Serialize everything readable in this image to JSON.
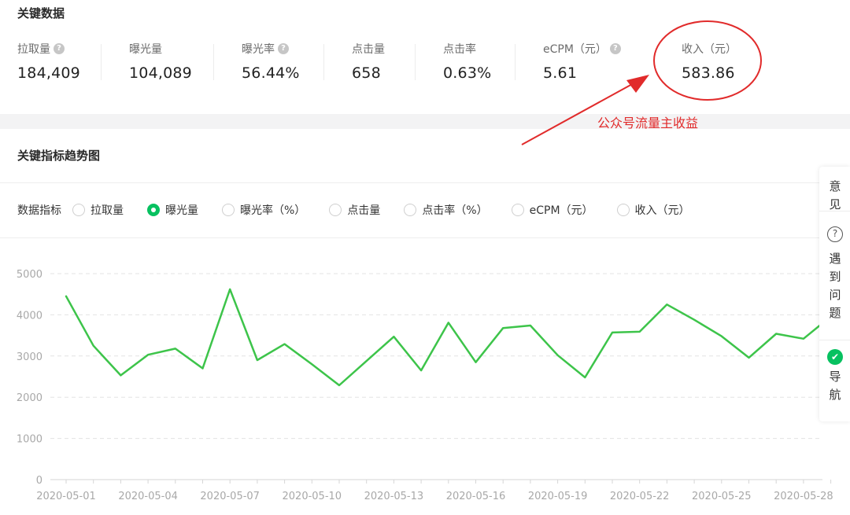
{
  "key_data": {
    "title": "关键数据",
    "metrics": [
      {
        "label": "拉取量",
        "value": "184,409",
        "help": true
      },
      {
        "label": "曝光量",
        "value": "104,089",
        "help": false
      },
      {
        "label": "曝光率",
        "value": "56.44%",
        "help": true
      },
      {
        "label": "点击量",
        "value": "658",
        "help": false
      },
      {
        "label": "点击率",
        "value": "0.63%",
        "help": false
      },
      {
        "label": "eCPM（元）",
        "value": "5.61",
        "help": true
      },
      {
        "label": "收入（元）",
        "value": "583.86",
        "help": false
      }
    ]
  },
  "annotation": {
    "text": "公众号流量主收益",
    "color": "#e12b2b"
  },
  "trend": {
    "title": "关键指标趋势图",
    "selector_label": "数据指标",
    "options": [
      {
        "label": "拉取量",
        "checked": false
      },
      {
        "label": "曝光量",
        "checked": true
      },
      {
        "label": "曝光率（%）",
        "checked": false
      },
      {
        "label": "点击量",
        "checked": false
      },
      {
        "label": "点击率（%）",
        "checked": false
      },
      {
        "label": "eCPM（元）",
        "checked": false
      },
      {
        "label": "收入（元）",
        "checked": false
      }
    ]
  },
  "float_panel": {
    "feedback": "意见",
    "help": "遇到问题",
    "help_icon": "question-circle-icon",
    "nav": "导航",
    "nav_icon": "nav-logo-icon"
  },
  "colors": {
    "accent": "#07c160",
    "line": "#3dc44a",
    "annotation": "#e12b2b"
  },
  "chart_data": {
    "type": "line",
    "x": [
      "2020-05-01",
      "2020-05-02",
      "2020-05-03",
      "2020-05-04",
      "2020-05-05",
      "2020-05-06",
      "2020-05-07",
      "2020-05-08",
      "2020-05-09",
      "2020-05-10",
      "2020-05-11",
      "2020-05-12",
      "2020-05-13",
      "2020-05-14",
      "2020-05-15",
      "2020-05-16",
      "2020-05-17",
      "2020-05-18",
      "2020-05-19",
      "2020-05-20",
      "2020-05-21",
      "2020-05-22",
      "2020-05-23",
      "2020-05-24",
      "2020-05-25",
      "2020-05-26",
      "2020-05-27",
      "2020-05-28",
      "2020-05-29"
    ],
    "x_tick_labels": [
      "2020-05-01",
      "2020-05-04",
      "2020-05-07",
      "2020-05-10",
      "2020-05-13",
      "2020-05-16",
      "2020-05-19",
      "2020-05-22",
      "2020-05-25",
      "2020-05-28"
    ],
    "series": [
      {
        "values": [
          4450,
          3250,
          2530,
          3030,
          3180,
          2700,
          4620,
          2900,
          3290,
          2800,
          2290,
          2880,
          3470,
          2650,
          3810,
          2850,
          3680,
          3740,
          3020,
          2480,
          3570,
          3590,
          4250,
          3880,
          3480,
          2960,
          3540,
          3420,
          3960
        ]
      }
    ],
    "ylim": [
      0,
      5000
    ],
    "yticks": [
      0,
      1000,
      2000,
      3000,
      4000,
      5000
    ],
    "grid": true
  }
}
